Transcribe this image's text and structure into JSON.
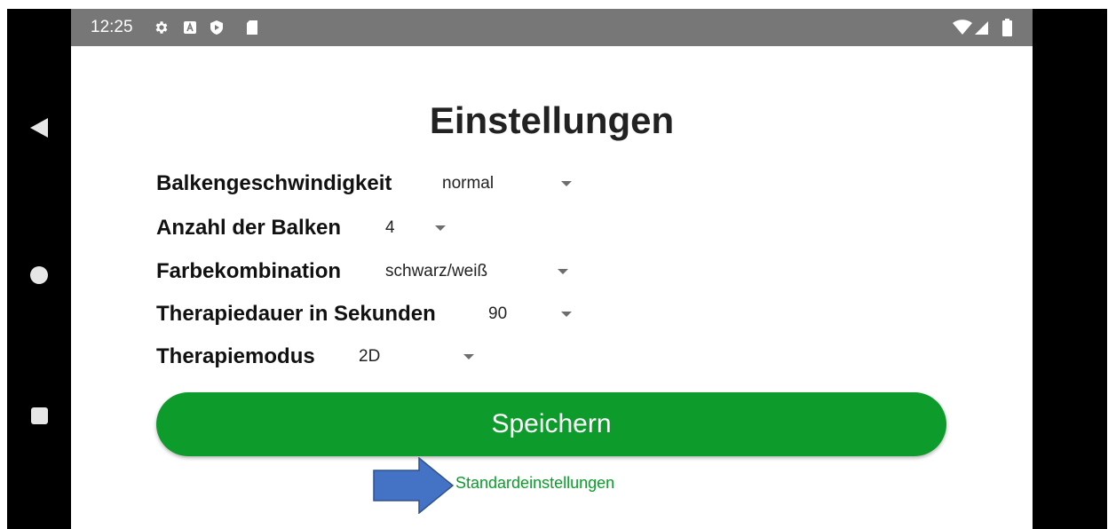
{
  "status_bar": {
    "time": "12:25",
    "icons": [
      "settings-icon",
      "a-badge-icon",
      "shield-play-icon",
      "sd-card-icon",
      "wifi-icon",
      "signal-icon",
      "battery-icon"
    ]
  },
  "nav_bar": {
    "buttons": [
      "back-icon",
      "home-icon",
      "recents-icon"
    ]
  },
  "screen": {
    "title": "Einstellungen",
    "settings": [
      {
        "label": "Balkengeschwindigkeit",
        "value": "normal"
      },
      {
        "label": "Anzahl der Balken",
        "value": "4"
      },
      {
        "label": "Farbekombination",
        "value": "schwarz/weiß"
      },
      {
        "label": "Therapiedauer in Sekunden",
        "value": "90"
      },
      {
        "label": "Therapiemodus",
        "value": "2D"
      }
    ],
    "save_label": "Speichern",
    "defaults_link": "Standardeinstellungen"
  },
  "colors": {
    "accent_green": "#0d9b2c",
    "status_bar": "#777777",
    "annotation_arrow": "#4472c4"
  }
}
